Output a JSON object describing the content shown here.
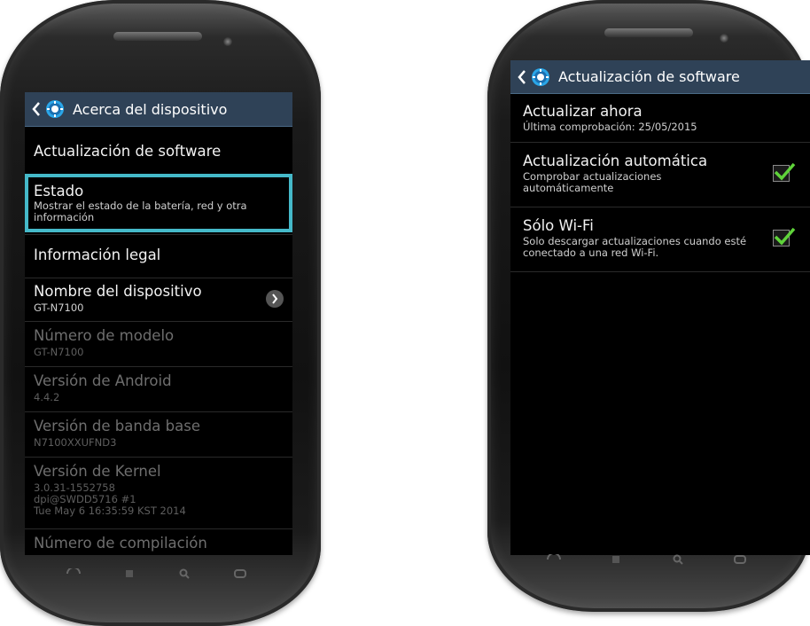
{
  "left_screen": {
    "header": {
      "title": "Acerca del dispositivo"
    },
    "items": [
      {
        "title": "Actualización de software",
        "subtitle": ""
      },
      {
        "title": "Estado",
        "subtitle": "Mostrar el estado de la batería, red y otra información"
      },
      {
        "title": "Información legal",
        "subtitle": ""
      },
      {
        "title": "Nombre del dispositivo",
        "subtitle": "GT-N7100"
      },
      {
        "title": "Número de modelo",
        "subtitle": "GT-N7100"
      },
      {
        "title": "Versión de Android",
        "subtitle": "4.4.2"
      },
      {
        "title": "Versión de banda base",
        "subtitle": "N7100XXUFND3"
      },
      {
        "title": "Versión de Kernel",
        "subtitle_lines": [
          "3.0.31-1552758",
          "dpi@SWDD5716 #1",
          "Tue May 6 16:35:59 KST 2014"
        ]
      },
      {
        "title": "Número de compilación",
        "subtitle": ""
      }
    ]
  },
  "right_screen": {
    "header": {
      "title": "Actualización de software"
    },
    "items": [
      {
        "title": "Actualizar ahora",
        "subtitle": "Última comprobación: 25/05/2015"
      },
      {
        "title": "Actualización automática",
        "subtitle": "Comprobar actualizaciones automáticamente",
        "checked": true
      },
      {
        "title": "Sólo Wi-Fi",
        "subtitle": "Solo descargar actualizaciones cuando esté conectado a una red Wi-Fi.",
        "checked": true
      }
    ]
  },
  "colors": {
    "action_bar": "#2f4257",
    "highlight": "#45b9c9",
    "check": "#5fd33a",
    "gear": "#2aa6e8"
  },
  "icons": [
    "back-chevron-icon",
    "settings-gear-icon",
    "chevron-right-icon",
    "checkmark-icon",
    "back-key-icon",
    "menu-key-icon",
    "search-key-icon",
    "home-key-icon"
  ]
}
